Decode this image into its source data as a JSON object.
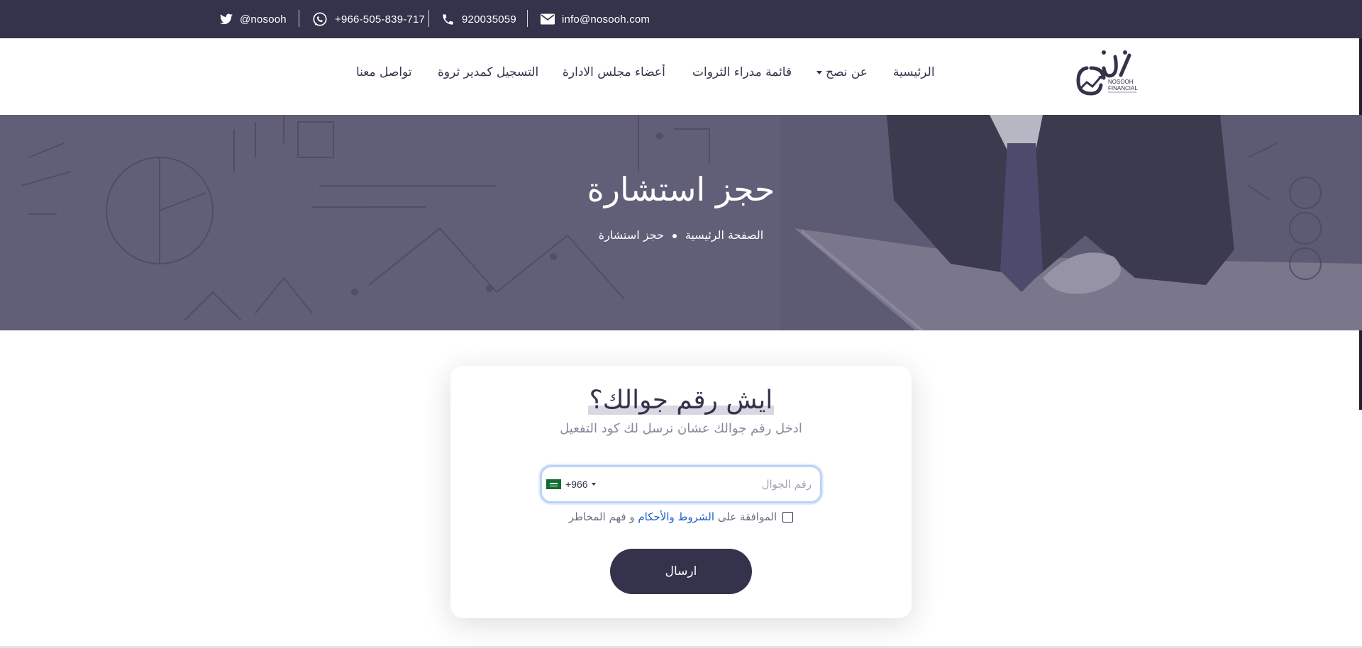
{
  "topbar": {
    "twitter": "@nosooh",
    "whatsapp": "+966-505-839-717",
    "phone": "920035059",
    "email": "info@nosooh.com",
    "icons": [
      "twitter-icon",
      "whatsapp-icon",
      "phone-icon",
      "mail-icon"
    ]
  },
  "nav": {
    "home": "الرئيسية",
    "about": "عن نصح",
    "wealth_managers": "قائمة مدراء الثروات",
    "board": "أعضاء مجلس الادارة",
    "register": "التسجيل كمدير ثروة",
    "contact": "تواصل معنا"
  },
  "logo": {
    "mark": "نصح",
    "en_line1": "NOSOOH",
    "en_line2": "FINANCIAL"
  },
  "hero": {
    "title": "حجز استشارة",
    "breadcrumb_home": "الصفحة الرئيسية",
    "breadcrumb_current": "حجز استشارة"
  },
  "form": {
    "title": "ايش رقم جوالك؟",
    "subtitle": "ادخل رقم جوالك عشان نرسل لك كود التفعيل",
    "phone_placeholder": "رقم الجوال",
    "phone_value": "",
    "country_code": "+966",
    "consent_prefix": "الموافقة على",
    "consent_link": "الشروط والأحكام",
    "consent_suffix": "و فهم المخاطر",
    "consent_checked": false,
    "submit_label": "ارسال"
  },
  "colors": {
    "primary": "#35334b",
    "link": "#1e5fc8",
    "focus_ring": "#bcd2f7"
  }
}
